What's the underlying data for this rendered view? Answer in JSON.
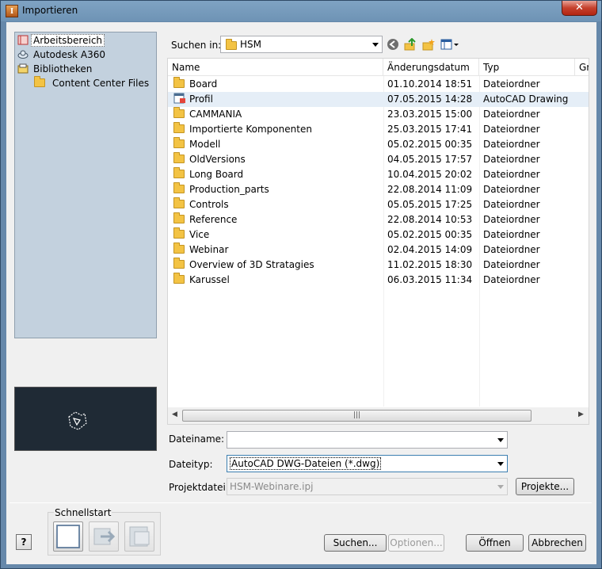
{
  "window": {
    "title": "Importieren"
  },
  "sidebar": {
    "items": [
      {
        "label": "Arbeitsbereich",
        "icon": "workspace-icon",
        "selected": true
      },
      {
        "label": "Autodesk A360",
        "icon": "cloud-icon"
      },
      {
        "label": "Bibliotheken",
        "icon": "library-icon"
      },
      {
        "label": "Content Center Files",
        "icon": "folder-icon"
      }
    ]
  },
  "toolbar": {
    "lookin_label": "Suchen in:",
    "lookin_value": "HSM"
  },
  "filelist": {
    "columns": [
      "Name",
      "Änderungsdatum",
      "Typ",
      "Gr"
    ],
    "rows": [
      {
        "name": "Board",
        "date": "01.10.2014 18:51",
        "type": "Dateiordner",
        "kind": "folder"
      },
      {
        "name": "Profil",
        "date": "07.05.2015 14:28",
        "type": "AutoCAD Drawing",
        "kind": "dwg",
        "selected": true
      },
      {
        "name": "CAMMANIA",
        "date": "23.03.2015 15:00",
        "type": "Dateiordner",
        "kind": "folder"
      },
      {
        "name": "Importierte Komponenten",
        "date": "25.03.2015 17:41",
        "type": "Dateiordner",
        "kind": "folder"
      },
      {
        "name": "Modell",
        "date": "05.02.2015 00:35",
        "type": "Dateiordner",
        "kind": "folder"
      },
      {
        "name": "OldVersions",
        "date": "04.05.2015 17:57",
        "type": "Dateiordner",
        "kind": "folder"
      },
      {
        "name": "Long Board",
        "date": "10.04.2015 20:02",
        "type": "Dateiordner",
        "kind": "folder"
      },
      {
        "name": "Production_parts",
        "date": "22.08.2014 11:09",
        "type": "Dateiordner",
        "kind": "folder"
      },
      {
        "name": "Controls",
        "date": "05.05.2015 17:25",
        "type": "Dateiordner",
        "kind": "folder"
      },
      {
        "name": "Reference",
        "date": "22.08.2014 10:53",
        "type": "Dateiordner",
        "kind": "folder"
      },
      {
        "name": "Vice",
        "date": "05.02.2015 00:35",
        "type": "Dateiordner",
        "kind": "folder"
      },
      {
        "name": "Webinar",
        "date": "02.04.2015 14:09",
        "type": "Dateiordner",
        "kind": "folder"
      },
      {
        "name": "Overview of 3D Stratagies",
        "date": "11.02.2015 18:30",
        "type": "Dateiordner",
        "kind": "folder"
      },
      {
        "name": "Karussel",
        "date": "06.03.2015 11:34",
        "type": "Dateiordner",
        "kind": "folder"
      }
    ]
  },
  "form": {
    "filename_label": "Dateiname:",
    "filename_value": "",
    "filetype_label": "Dateityp:",
    "filetype_value": "AutoCAD DWG-Dateien (*.dwg)",
    "project_label": "Projektdatei:",
    "project_value": "HSM-Webinare.ipj",
    "projects_button": "Projekte..."
  },
  "quickstart": {
    "label": "Schnellstart"
  },
  "buttons": {
    "help": "?",
    "search": "Suchen...",
    "options": "Optionen...",
    "open": "Öffnen",
    "cancel": "Abbrechen"
  },
  "colors": {
    "selection": "#e5eef7",
    "panel": "#c3d1de",
    "folder": "#f3c344"
  }
}
